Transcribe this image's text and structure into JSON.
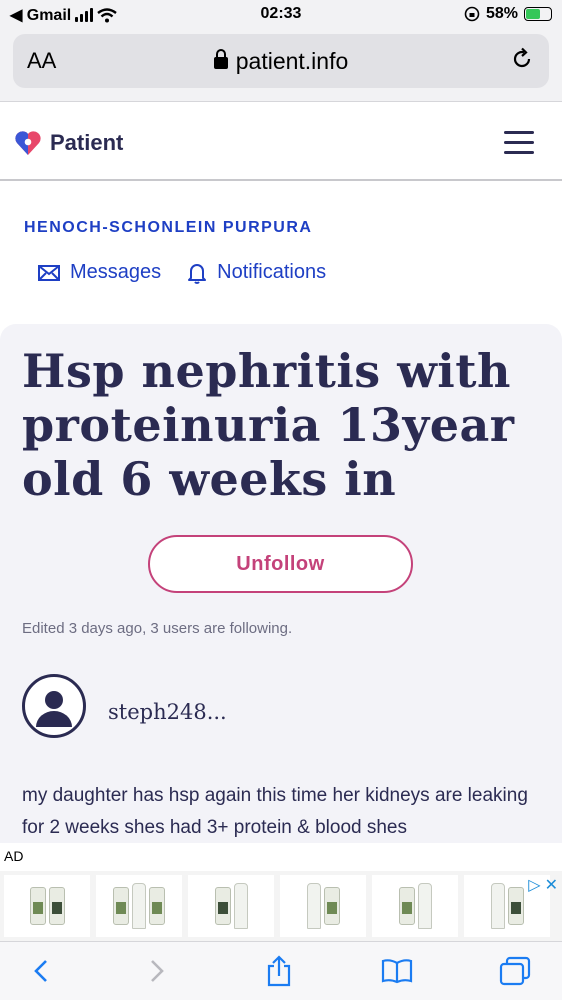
{
  "status_bar": {
    "back_app": "◀ Gmail",
    "time": "02:33",
    "battery": "58%",
    "battery_level": 0.58
  },
  "url_bar": {
    "text_size_label": "AA",
    "url": "patient.info"
  },
  "header": {
    "logo_text": "Patient"
  },
  "group": {
    "title": "HENOCH-SCHONLEIN PURPURA",
    "messages_label": "Messages",
    "notifications_label": "Notifications"
  },
  "post": {
    "title": "Hsp nephritis with proteinuria 13year old 6 weeks in",
    "unfollow_label": "Unfollow",
    "meta": "Edited 3 days ago, 3 users are following.",
    "username": "steph248...",
    "body": "my daughter has hsp again this time her kidneys are leaking for 2 weeks shes had 3+ protein & blood shes"
  },
  "ad": {
    "label": "AD",
    "choices_icon": "▷",
    "close_icon": "✕"
  },
  "colors": {
    "brand_navy": "#2b2b52",
    "link_blue": "#1e3fc4",
    "unfollow_pink": "#c4427a",
    "card_bg": "#f3f3f8",
    "ios_blue": "#1b7cf2"
  }
}
